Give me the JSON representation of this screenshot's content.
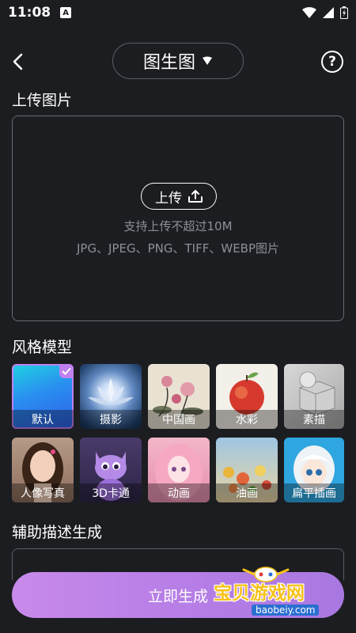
{
  "status": {
    "time": "11:08",
    "app_icon": "A"
  },
  "header": {
    "title": "图生图",
    "back_icon": "chevron-left-icon",
    "help_label": "?"
  },
  "upload": {
    "section_title": "上传图片",
    "button_label": "上传",
    "hint_size": "支持上传不超过10M",
    "hint_formats": "JPG、JPEG、PNG、TIFF、WEBP图片"
  },
  "styles": {
    "section_title": "风格模型",
    "selected": "默认",
    "items": [
      {
        "label": "默认"
      },
      {
        "label": "摄影"
      },
      {
        "label": "中国画"
      },
      {
        "label": "水彩"
      },
      {
        "label": "素描"
      },
      {
        "label": "人像写真"
      },
      {
        "label": "3D卡通"
      },
      {
        "label": "动画"
      },
      {
        "label": "油画"
      },
      {
        "label": "扁平插画"
      }
    ]
  },
  "assist": {
    "section_title": "辅助描述生成"
  },
  "footer": {
    "generate_label": "立即生成"
  },
  "watermark": {
    "title": "宝贝游戏网",
    "url": "baobeiy.com"
  },
  "colors": {
    "background": "#1c1d21",
    "accent": "#c080f0",
    "button": "#b77ee6"
  }
}
